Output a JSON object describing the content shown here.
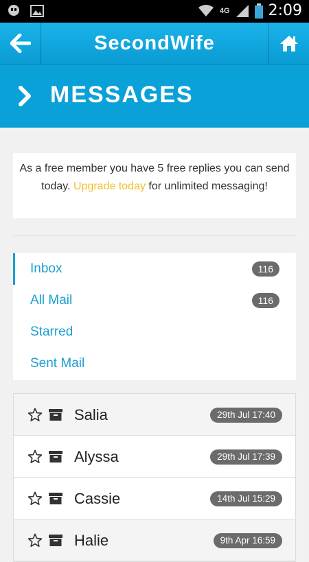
{
  "statusbar": {
    "network": "4G",
    "time": "2:09"
  },
  "topbar": {
    "title": "SecondWife"
  },
  "hero": {
    "heading": "MESSAGES"
  },
  "notice": {
    "text_before": "As a free member you have 5 free replies you can send today.",
    "link": "Upgrade today",
    "text_after": "for unlimited messaging!"
  },
  "folders": [
    {
      "label": "Inbox",
      "count": "116"
    },
    {
      "label": "All Mail",
      "count": "116"
    },
    {
      "label": "Starred",
      "count": ""
    },
    {
      "label": "Sent Mail",
      "count": ""
    }
  ],
  "messages": [
    {
      "name": "Salia",
      "date": "29th Jul 17:40"
    },
    {
      "name": "Alyssa",
      "date": "29th Jul 17:39"
    },
    {
      "name": "Cassie",
      "date": "14th Jul 15:29"
    },
    {
      "name": "Halie",
      "date": "9th Apr 16:59"
    }
  ],
  "colors": {
    "accent": "#0aa0d8",
    "link": "#f2c12e",
    "badge": "#6b6b6b"
  }
}
